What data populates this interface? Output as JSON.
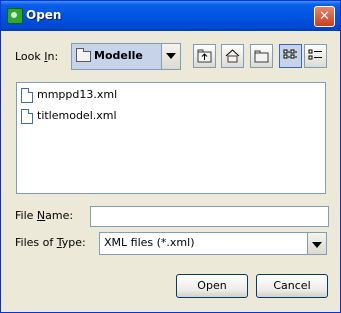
{
  "window": {
    "title": "Open",
    "close_label": "✕"
  },
  "look_in": {
    "label_prefix": "Look ",
    "label_mnemonic": "I",
    "label_suffix": "n:",
    "value": "Modelle"
  },
  "files": [
    {
      "name": "mmppd13.xml"
    },
    {
      "name": "titlemodel.xml"
    }
  ],
  "file_name": {
    "label_prefix": "File ",
    "label_mnemonic": "N",
    "label_suffix": "ame:",
    "value": ""
  },
  "file_type": {
    "label_prefix": "Files of ",
    "label_mnemonic": "T",
    "label_suffix": "ype:",
    "value": "XML files (*.xml)"
  },
  "buttons": {
    "open": "Open",
    "cancel": "Cancel"
  },
  "icons": [
    "up-one-level-icon",
    "home-icon",
    "new-folder-icon",
    "list-view-icon",
    "details-view-icon"
  ],
  "colors": {
    "title_bar": "#0054e3",
    "dialog_bg": "#ece9d8",
    "border": "#7f9db9",
    "selection": "#c6d3e8"
  }
}
